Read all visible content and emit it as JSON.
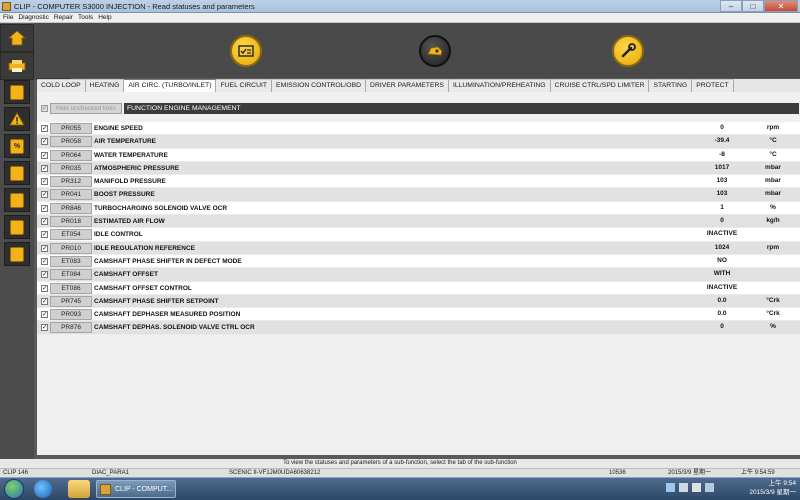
{
  "window": {
    "title": "CLIP - COMPUTER S3000 INJECTION - Read statuses and parameters"
  },
  "menu": [
    "File",
    "Diagnostic",
    "Repair",
    "Tools",
    "Help"
  ],
  "sidebar": {
    "top_buttons": [
      "home-icon",
      "back-arrow-icon",
      "printer-icon",
      "help-icon"
    ],
    "buttons": [
      "calculator-icon",
      "warning-icon",
      "percent-icon",
      "car-icon",
      "book-icon",
      "car-tools-icon",
      "barcode-icon"
    ]
  },
  "toolbar": {
    "buttons": [
      "checklist-icon",
      "engine-icon",
      "wrench-icon"
    ]
  },
  "tabs": [
    {
      "label": "COLD LOOP",
      "active": false
    },
    {
      "label": "HEATING",
      "active": false
    },
    {
      "label": "AIR CIRC. (TURBO/INLET)",
      "active": true
    },
    {
      "label": "FUEL CIRCUIT",
      "active": false
    },
    {
      "label": "EMISSION CONTROL/OBD",
      "active": false
    },
    {
      "label": "DRIVER PARAMETERS",
      "active": false
    },
    {
      "label": "ILLUMINATION/PREHEATING",
      "active": false
    },
    {
      "label": "CRUISE CTRL/SPD LIMITER",
      "active": false
    },
    {
      "label": "STARTING",
      "active": false
    },
    {
      "label": "PROTECT",
      "active": false
    }
  ],
  "filter": {
    "hide_label": "Hide unchecked lines",
    "function_label": "FUNCTION ENGINE MANAGEMENT"
  },
  "rows": [
    {
      "code": "PR055",
      "name": "ENGINE SPEED",
      "value": "0",
      "unit": "rpm"
    },
    {
      "code": "PR058",
      "name": "AIR TEMPERATURE",
      "value": "-39.4",
      "unit": "°C"
    },
    {
      "code": "PR064",
      "name": "WATER TEMPERATURE",
      "value": "-8",
      "unit": "°C"
    },
    {
      "code": "PR035",
      "name": "ATMOSPHERIC PRESSURE",
      "value": "1017",
      "unit": "mbar"
    },
    {
      "code": "PR312",
      "name": "MANIFOLD PRESSURE",
      "value": "103",
      "unit": "mbar"
    },
    {
      "code": "PR041",
      "name": "BOOST PRESSURE",
      "value": "103",
      "unit": "mbar"
    },
    {
      "code": "PR846",
      "name": "TURBOCHARGING SOLENOID VALVE OCR",
      "value": "1",
      "unit": "%"
    },
    {
      "code": "PR018",
      "name": "ESTIMATED AIR FLOW",
      "value": "0",
      "unit": "kg/h"
    },
    {
      "code": "ET054",
      "name": "IDLE CONTROL",
      "value": "INACTIVE",
      "unit": ""
    },
    {
      "code": "PR010",
      "name": "IDLE REGULATION REFERENCE",
      "value": "1024",
      "unit": "rpm"
    },
    {
      "code": "ET083",
      "name": "CAMSHAFT PHASE SHIFTER IN DEFECT MODE",
      "value": "NO",
      "unit": ""
    },
    {
      "code": "ET084",
      "name": "CAMSHAFT OFFSET",
      "value": "WITH",
      "unit": ""
    },
    {
      "code": "ET086",
      "name": "CAMSHAFT OFFSET CONTROL",
      "value": "INACTIVE",
      "unit": ""
    },
    {
      "code": "PR745",
      "name": "CAMSHAFT PHASE SHIFTER SETPOINT",
      "value": "0.0",
      "unit": "°Crk"
    },
    {
      "code": "PR093",
      "name": "CAMSHAFT DEPHASER MEASURED POSITION",
      "value": "0.0",
      "unit": "°Crk"
    },
    {
      "code": "PR876",
      "name": "CAMSHAFT DEPHAS. SOLENOID VALVE CTRL OCR",
      "value": "0",
      "unit": "%"
    }
  ],
  "status_message": "To view the statuses and parameters of a sub-function, select the tab of the sub-function",
  "statusbar": {
    "clip": "CLIP 146",
    "diac": "DIAC_PARA1",
    "vehicle": "SCENIC II-VF1JM0UDA60638212",
    "number": "10536",
    "date": "2015/3/9 星期一",
    "time": "上午 9:54:59"
  },
  "taskbar": {
    "task_label": "CLIP - COMPUT...",
    "clock_time": "上午 9:54",
    "clock_date": "2015/3/9 星期一"
  }
}
